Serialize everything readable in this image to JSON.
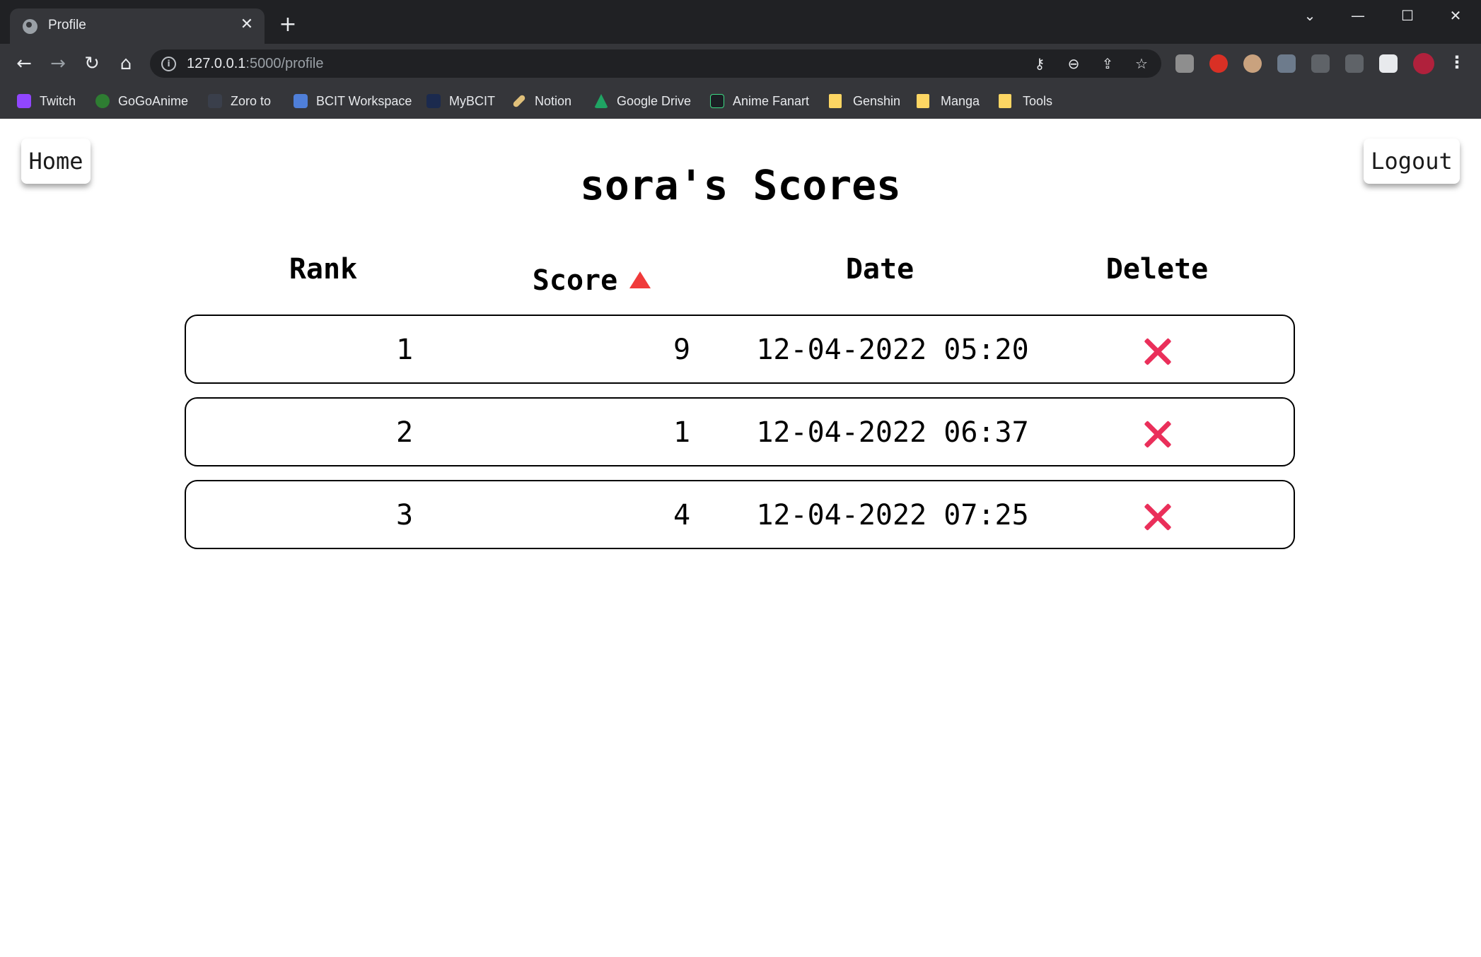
{
  "browser": {
    "tab_title": "Profile",
    "url_host": "127.0.0.1",
    "url_path": ":5000/profile",
    "bookmarks": [
      {
        "label": "Twitch",
        "color": "#9146ff"
      },
      {
        "label": "GoGoAnime",
        "color": "#2e7d32"
      },
      {
        "label": "Zoro to",
        "color": "#3a3f4b"
      },
      {
        "label": "BCIT Workspace",
        "color": "#4f7fd9"
      },
      {
        "label": "MyBCIT",
        "color": "#1b2a4e"
      },
      {
        "label": "Notion",
        "color": "#e0c07a"
      },
      {
        "label": "Google Drive",
        "color": "#1fa463"
      },
      {
        "label": "Anime Fanart",
        "color": "#1b1f24"
      },
      {
        "label": "Genshin",
        "color": "#fdd663"
      },
      {
        "label": "Manga",
        "color": "#fdd663"
      },
      {
        "label": "Tools",
        "color": "#fdd663"
      }
    ]
  },
  "page": {
    "home_label": "Home",
    "logout_label": "Logout",
    "title": "sora's Scores",
    "headers": {
      "rank": "Rank",
      "score": "Score",
      "date": "Date",
      "delete": "Delete"
    },
    "sort": {
      "column": "Score",
      "direction": "ascending",
      "arrow_color": "#f03a3a"
    },
    "delete_color": "#ea2f5a",
    "rows": [
      {
        "rank": "1",
        "score": "9",
        "date": "12-04-2022 05:20"
      },
      {
        "rank": "2",
        "score": "1",
        "date": "12-04-2022 06:37"
      },
      {
        "rank": "3",
        "score": "4",
        "date": "12-04-2022 07:25"
      }
    ]
  }
}
